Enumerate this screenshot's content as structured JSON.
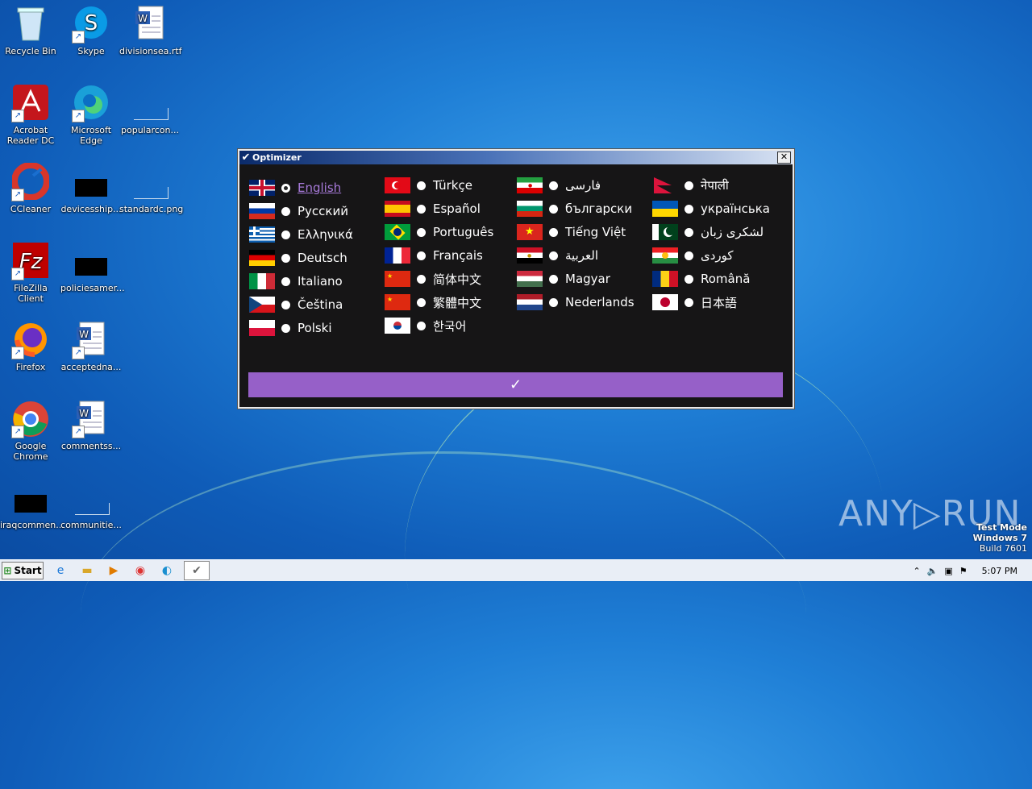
{
  "desktop": {
    "icons": [
      {
        "label": "Recycle Bin",
        "icon": "recycle-bin-icon"
      },
      {
        "label": "Skype",
        "icon": "skype-icon"
      },
      {
        "label": "divisionsea.rtf",
        "icon": "word-document-icon"
      },
      {
        "label": "Acrobat Reader DC",
        "icon": "acrobat-icon"
      },
      {
        "label": "Microsoft Edge",
        "icon": "edge-icon"
      },
      {
        "label": "popularcon...",
        "icon": "file-icon"
      },
      {
        "label": "CCleaner",
        "icon": "ccleaner-icon"
      },
      {
        "label": "devicesship...",
        "icon": "file-icon"
      },
      {
        "label": "standardc.png",
        "icon": "image-file-icon"
      },
      {
        "label": "FileZilla Client",
        "icon": "filezilla-icon"
      },
      {
        "label": "policiesamer...",
        "icon": "file-icon"
      },
      {
        "label": "Firefox",
        "icon": "firefox-icon"
      },
      {
        "label": "acceptedna...",
        "icon": "word-document-icon"
      },
      {
        "label": "Google Chrome",
        "icon": "chrome-icon"
      },
      {
        "label": "commentss...",
        "icon": "word-document-icon"
      },
      {
        "label": "iraqcommen...",
        "icon": "file-icon"
      },
      {
        "label": "communitie...",
        "icon": "file-icon"
      }
    ]
  },
  "dialog": {
    "title": "Optimizer",
    "close_label": "✕",
    "ok_label": "✓",
    "selected": "English",
    "languages": [
      [
        "English",
        "Русский",
        "Ελληνικά",
        "Deutsch",
        "Italiano",
        "Čeština",
        "Polski"
      ],
      [
        "Türkçe",
        "Español",
        "Português",
        "Français",
        "简体中文",
        "繁體中文",
        "한국어"
      ],
      [
        "فارسی",
        "български",
        "Tiếng Việt",
        "العربية",
        "Magyar",
        "Nederlands"
      ],
      [
        "नेपाली",
        "українська",
        "لشکری زبان",
        "کوردی",
        "Română",
        "日本語"
      ]
    ]
  },
  "taskbar": {
    "start_label": "Start",
    "clock": "5:07 PM"
  },
  "watermark": {
    "line1": "Test Mode",
    "line2": "Windows 7",
    "line3": "Build 7601",
    "brand": "ANY▷RUN"
  }
}
